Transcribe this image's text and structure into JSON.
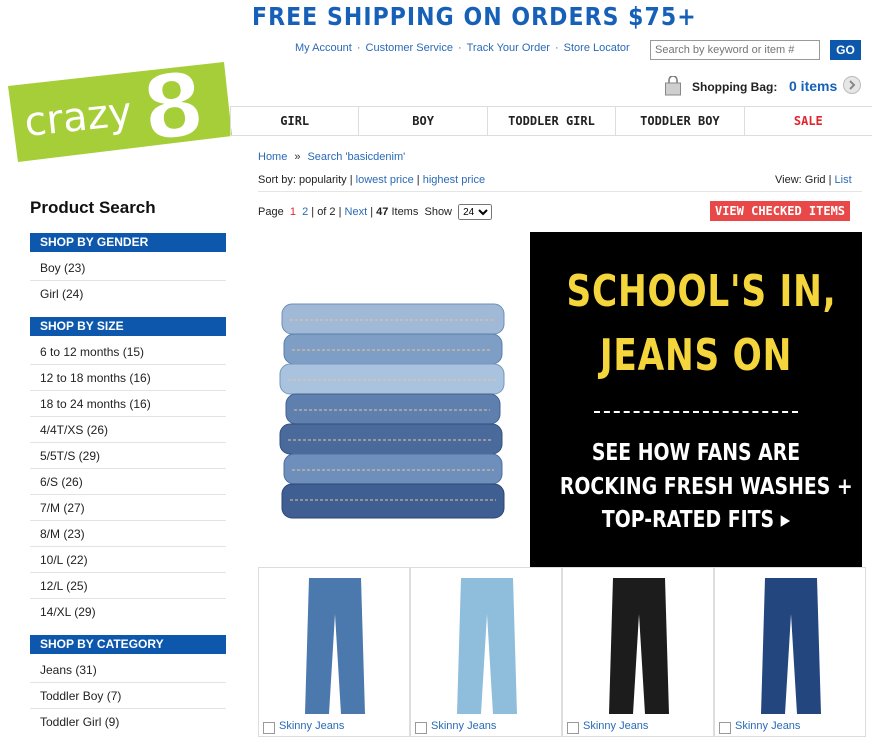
{
  "header": {
    "promo": "FREE SHIPPING ON ORDERS $75+",
    "links": [
      "My Account",
      "Customer Service",
      "Track Your Order",
      "Store Locator"
    ],
    "search_placeholder": "Search by keyword or item #",
    "go_label": "GO",
    "bag_label": "Shopping Bag:",
    "bag_count": "0 items"
  },
  "logo": {
    "text": "crazy",
    "numeral": "8",
    "bg_color": "#a6ce39"
  },
  "nav": [
    "GIRL",
    "BOY",
    "TODDLER GIRL",
    "TODDLER BOY",
    "SALE"
  ],
  "breadcrumb": {
    "home": "Home",
    "sep": "»",
    "search": "Search 'basicdenim'"
  },
  "sort": {
    "label": "Sort by:",
    "current": "popularity",
    "options": [
      "lowest price",
      "highest price"
    ]
  },
  "view": {
    "label": "View:",
    "current": "Grid",
    "alt": "List"
  },
  "pager": {
    "label": "Page",
    "page1": "1",
    "page2": "2",
    "of": "of 2",
    "next": "Next",
    "count": "47",
    "items_label": "Items",
    "show_label": "Show",
    "show_value": "24"
  },
  "view_checked": "VIEW CHECKED ITEMS",
  "sidebar": {
    "title": "Product Search",
    "gender": {
      "head": "SHOP BY GENDER",
      "items": [
        "Boy (23)",
        "Girl (24)"
      ]
    },
    "size": {
      "head": "SHOP BY SIZE",
      "items": [
        "6 to 12 months (15)",
        "12 to 18 months (16)",
        "18 to 24 months (16)",
        "4/4T/XS (26)",
        "5/5T/S (29)",
        "6/S (26)",
        "7/M (27)",
        "8/M (23)",
        "10/L (22)",
        "12/L (25)",
        "14/XL (29)"
      ]
    },
    "category": {
      "head": "SHOP BY CATEGORY",
      "items": [
        "Jeans (31)",
        "Toddler Boy (7)",
        "Toddler Girl (9)"
      ]
    }
  },
  "banner": {
    "line1": "SCHOOL'S IN,",
    "line2": "JEANS ON",
    "sub1": "SEE HOW FANS ARE",
    "sub2": "ROCKING FRESH WASHES +",
    "sub3": "TOP-RATED FITS ▸"
  },
  "products": [
    {
      "name": "Skinny Jeans",
      "color": "#4b78ad"
    },
    {
      "name": "Skinny Jeans",
      "color": "#8fbddc"
    },
    {
      "name": "Skinny Jeans",
      "color": "#1c1c1c"
    },
    {
      "name": "Skinny Jeans",
      "color": "#24467e"
    }
  ]
}
